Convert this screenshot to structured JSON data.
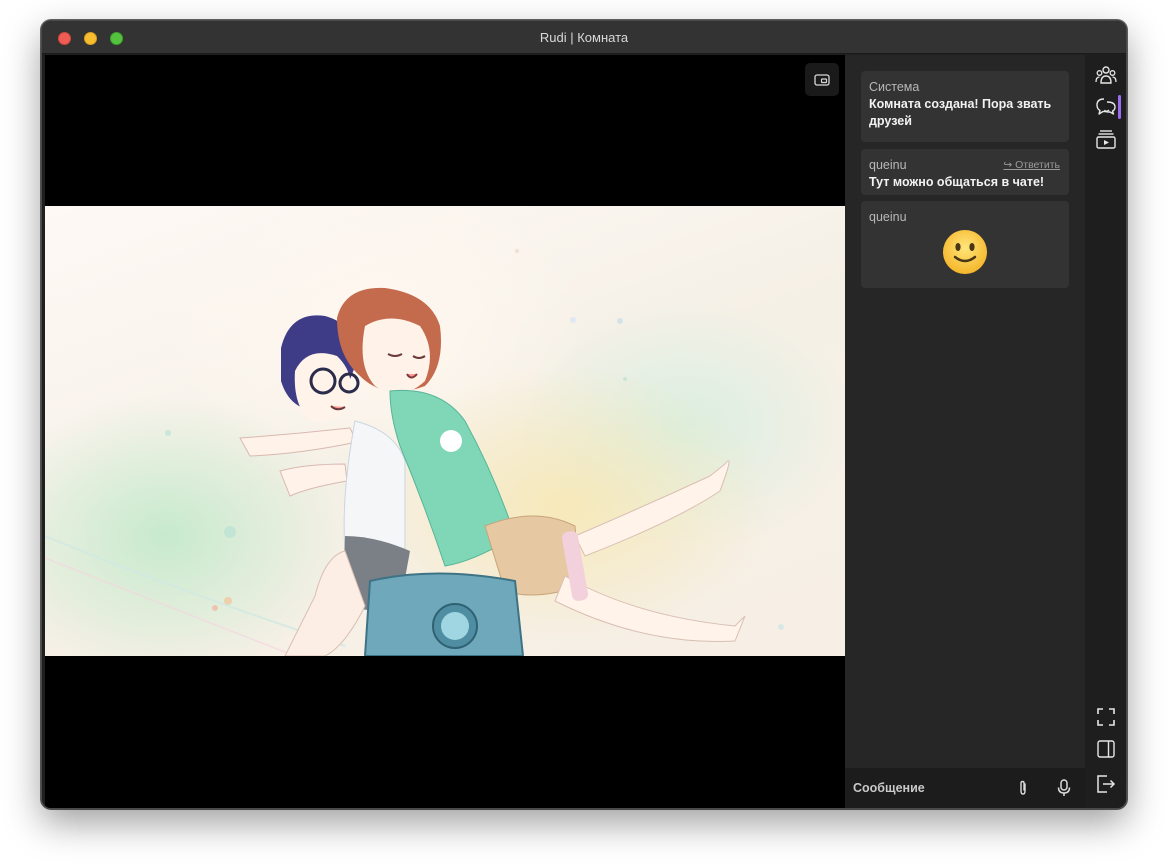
{
  "window": {
    "title": "Rudi | Комната"
  },
  "player": {
    "pip_icon": "picture-in-picture-icon"
  },
  "chat": {
    "messages": [
      {
        "author": "Система",
        "text": "Комната создана! Пора звать друзей"
      },
      {
        "author": "queinu",
        "text": "Тут можно общаться в чате!",
        "reply_label": "↪ Ответить"
      },
      {
        "author": "queinu",
        "emoji": "slightly-smiling-face"
      }
    ],
    "composer": {
      "placeholder": "Сообщение",
      "attach_icon": "paperclip-icon",
      "mic_icon": "microphone-icon"
    }
  },
  "rail": {
    "items": [
      "people-icon",
      "chat-icon",
      "playlist-icon"
    ],
    "bottom": [
      "fullscreen-icon",
      "sidebar-toggle-icon",
      "exit-icon"
    ],
    "accent": "#9b6cf0"
  }
}
